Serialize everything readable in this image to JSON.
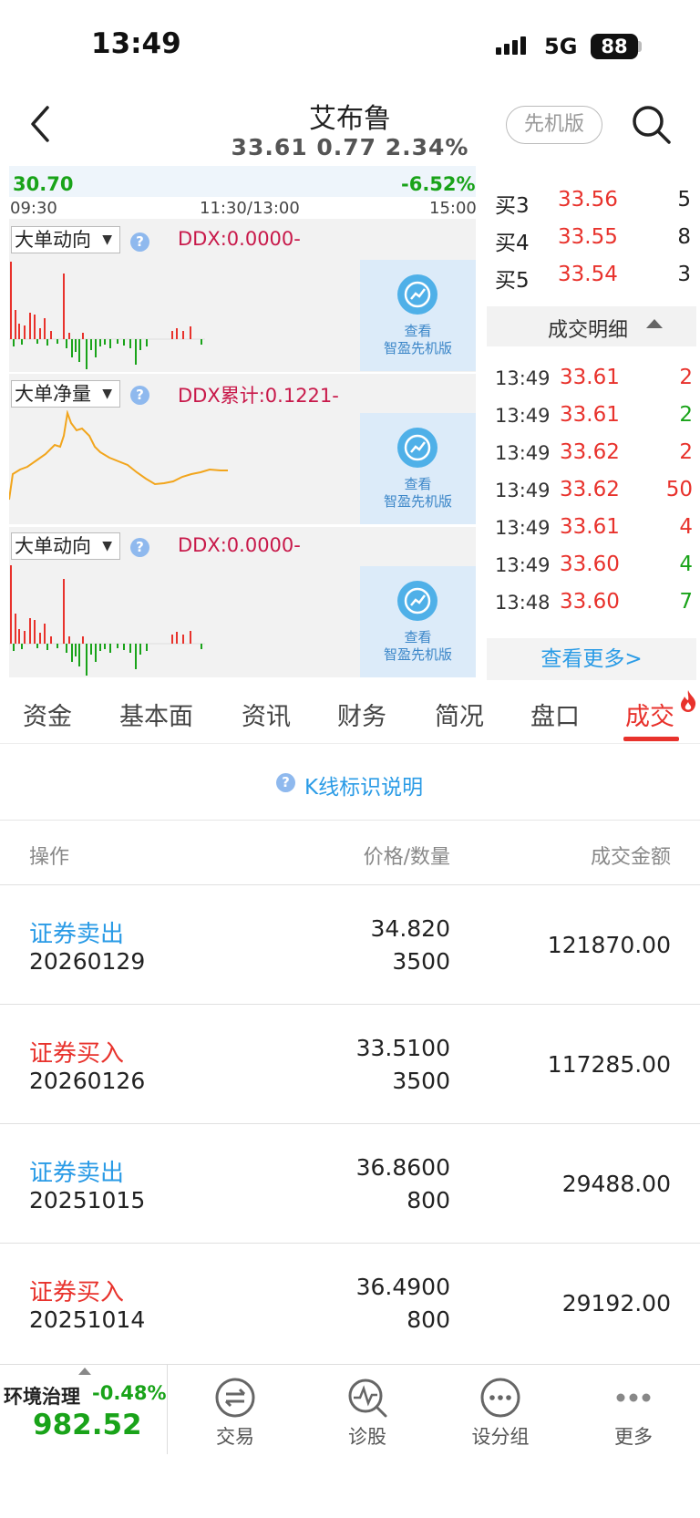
{
  "status": {
    "time": "13:49",
    "network": "5G",
    "battery": "88"
  },
  "header": {
    "title": "艾布鲁",
    "quote": "33.61  0.77  2.34%",
    "pioneer_button": "先机版"
  },
  "mini_chart": {
    "low": "30.70",
    "pct": "-6.52%",
    "times": [
      "09:30",
      "11:30/13:00",
      "15:00"
    ]
  },
  "panels": [
    {
      "dropdown": "大单动向",
      "ddx": "DDX:0.0000-",
      "card_line1": "查看",
      "card_line2": "智盈先机版"
    },
    {
      "dropdown": "大单净量",
      "ddx": "DDX累计:0.1221-",
      "card_line1": "查看",
      "card_line2": "智盈先机版"
    },
    {
      "dropdown": "大单动向",
      "ddx": "DDX:0.0000-",
      "card_line1": "查看",
      "card_line2": "智盈先机版"
    }
  ],
  "order_book": [
    {
      "label": "买3",
      "price": "33.56",
      "qty": "5"
    },
    {
      "label": "买4",
      "price": "33.55",
      "qty": "8"
    },
    {
      "label": "买5",
      "price": "33.54",
      "qty": "3"
    }
  ],
  "trade_detail": {
    "title": "成交明细",
    "rows": [
      {
        "time": "13:49",
        "price": "33.61",
        "qty": "2",
        "dir": "red"
      },
      {
        "time": "13:49",
        "price": "33.61",
        "qty": "2",
        "dir": "green"
      },
      {
        "time": "13:49",
        "price": "33.62",
        "qty": "2",
        "dir": "red"
      },
      {
        "time": "13:49",
        "price": "33.62",
        "qty": "50",
        "dir": "red"
      },
      {
        "time": "13:49",
        "price": "33.61",
        "qty": "4",
        "dir": "red"
      },
      {
        "time": "13:49",
        "price": "33.60",
        "qty": "4",
        "dir": "green"
      },
      {
        "time": "13:48",
        "price": "33.60",
        "qty": "7",
        "dir": "green"
      }
    ],
    "more": "查看更多>"
  },
  "tabs": [
    "资金",
    "基本面",
    "资讯",
    "财务",
    "简况",
    "盘口",
    "成交"
  ],
  "kline_note": "K线标识说明",
  "table": {
    "headers": [
      "操作",
      "价格/数量",
      "成交金额"
    ],
    "rows": [
      {
        "op": "证券卖出",
        "type": "sell",
        "date": "20260129",
        "price": "34.820",
        "qty": "3500",
        "amount": "121870.00"
      },
      {
        "op": "证券买入",
        "type": "buy",
        "date": "20260126",
        "price": "33.5100",
        "qty": "3500",
        "amount": "117285.00"
      },
      {
        "op": "证券卖出",
        "type": "sell",
        "date": "20251015",
        "price": "36.8600",
        "qty": "800",
        "amount": "29488.00"
      },
      {
        "op": "证券买入",
        "type": "buy",
        "date": "20251014",
        "price": "36.4900",
        "qty": "800",
        "amount": "29192.00"
      }
    ]
  },
  "bottom_bar": {
    "index_name": "环境治理",
    "index_pct": "-0.48%",
    "index_value": "982.52",
    "items": [
      "交易",
      "诊股",
      "设分组",
      "更多"
    ]
  }
}
